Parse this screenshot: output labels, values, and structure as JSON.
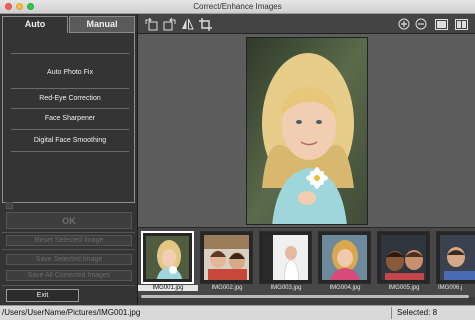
{
  "window": {
    "title": "Correct/Enhance Images"
  },
  "tabs": [
    {
      "label": "Auto"
    },
    {
      "label": "Manual"
    }
  ],
  "auto_panel": {
    "items": [
      {
        "label": "Auto Photo Fix"
      },
      {
        "label": "Red-Eye Correction"
      },
      {
        "label": "Face Sharpener"
      },
      {
        "label": "Digital Face Smoothing"
      }
    ]
  },
  "buttons": {
    "ok": "OK",
    "reset_selected": "Reset Selected Image",
    "save_selected": "Save Selected Image",
    "save_all": "Save All Corrected Images",
    "exit": "Exit"
  },
  "toolbar": {
    "left_icons": [
      "rotate-left-icon",
      "rotate-right-icon",
      "flip-icon",
      "crop-icon"
    ],
    "right_icons": [
      "zoom-in-icon",
      "zoom-out-icon",
      "full-screen-icon",
      "compare-icon"
    ]
  },
  "thumbnails": [
    {
      "name": "IMG001.jpg",
      "selected": true
    },
    {
      "name": "IMG002.jpg",
      "selected": false
    },
    {
      "name": "IMG003.jpg",
      "selected": false
    },
    {
      "name": "IMG004.jpg",
      "selected": false
    },
    {
      "name": "IMG005.jpg",
      "selected": false
    },
    {
      "name": "IMG006.j",
      "selected": false
    }
  ],
  "status": {
    "path": "/Users/UserName/Pictures/IMG001.jpg",
    "selected": "Selected: 8"
  },
  "colors": {
    "panel_bg": "#343434",
    "preview_bg": "#5d5d5d",
    "strip_bg": "#474747",
    "status_bg": "#d9d9d9"
  }
}
